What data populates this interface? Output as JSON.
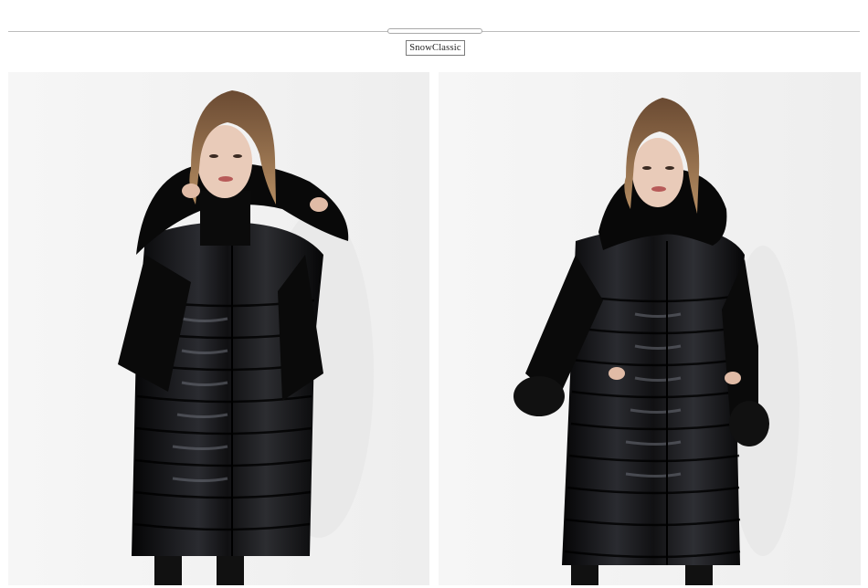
{
  "header": {
    "brand": "SnowClassic"
  },
  "photos": [
    {
      "subject": "model-left",
      "garment_color": "#0c0c0e",
      "background_color": "#f2f2f2"
    },
    {
      "subject": "model-right",
      "garment_color": "#0c0c0e",
      "background_color": "#f2f2f2"
    }
  ]
}
